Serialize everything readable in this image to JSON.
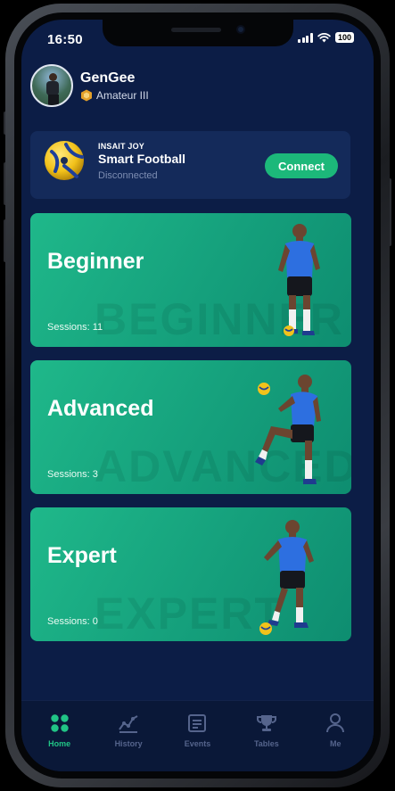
{
  "status_bar": {
    "time": "16:50",
    "battery": "100"
  },
  "profile": {
    "name": "GenGee",
    "rank": "Amateur III"
  },
  "device": {
    "brand": "INSAIT JOY",
    "name": "Smart Football",
    "status": "Disconnected",
    "connect_label": "Connect"
  },
  "levels": [
    {
      "title": "Beginner",
      "sessions": "Sessions: 11",
      "watermark": "BEGINNER"
    },
    {
      "title": "Advanced",
      "sessions": "Sessions: 3",
      "watermark": "ADVANCED"
    },
    {
      "title": "Expert",
      "sessions": "Sessions: 0",
      "watermark": "EXPERT"
    }
  ],
  "tabs": [
    {
      "label": "Home",
      "icon": "home-grid-icon",
      "active": true
    },
    {
      "label": "History",
      "icon": "history-chart-icon",
      "active": false
    },
    {
      "label": "Events",
      "icon": "events-list-icon",
      "active": false
    },
    {
      "label": "Tables",
      "icon": "trophy-icon",
      "active": false
    },
    {
      "label": "Me",
      "icon": "person-icon",
      "active": false
    }
  ],
  "colors": {
    "background": "#0c1d46",
    "card": "#142a5a",
    "accent_green": "#1cb87a",
    "level_card": "#1fb88a",
    "inactive_tab": "#55648c"
  }
}
